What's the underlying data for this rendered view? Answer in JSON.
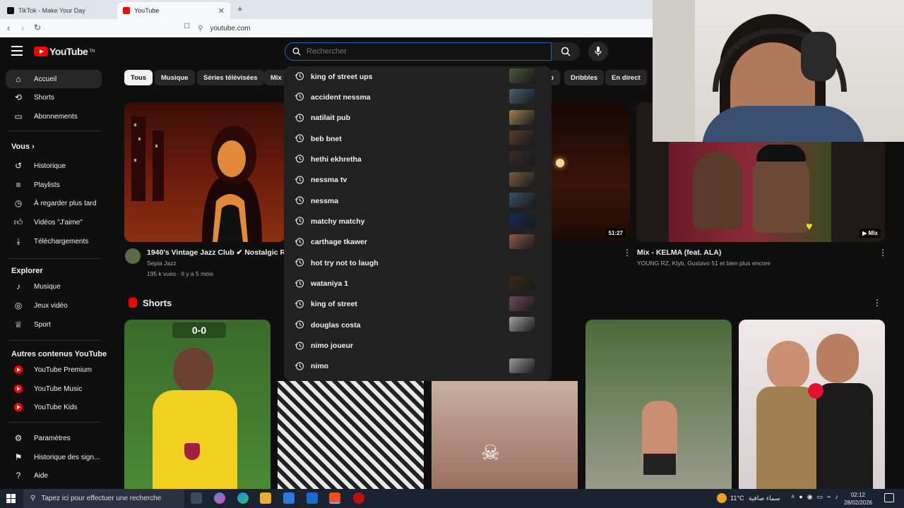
{
  "browser": {
    "tabs": [
      {
        "title": "TikTok - Make Your Day",
        "active": false
      },
      {
        "title": "YouTube",
        "active": true
      }
    ],
    "url": "youtube.com"
  },
  "header": {
    "logo_text": "YouTube",
    "logo_tm": "TN",
    "search_placeholder": "Rechercher"
  },
  "sidebar": {
    "main": [
      {
        "label": "Accueil",
        "icon": "home-icon"
      },
      {
        "label": "Shorts",
        "icon": "shorts-icon"
      },
      {
        "label": "Abonnements",
        "icon": "subscriptions-icon"
      }
    ],
    "you_heading": "Vous",
    "you": [
      {
        "label": "Historique",
        "icon": "history-icon"
      },
      {
        "label": "Playlists",
        "icon": "playlist-icon"
      },
      {
        "label": "À regarder plus tard",
        "icon": "clock-icon"
      },
      {
        "label": "Vidéos \"J'aime\"",
        "icon": "like-icon"
      },
      {
        "label": "Téléchargements",
        "icon": "download-icon"
      }
    ],
    "explore_heading": "Explorer",
    "explore": [
      {
        "label": "Musique",
        "icon": "music-icon"
      },
      {
        "label": "Jeux vidéo",
        "icon": "gaming-icon"
      },
      {
        "label": "Sport",
        "icon": "trophy-icon"
      }
    ],
    "more_heading": "Autres contenus YouTube",
    "more": [
      {
        "label": "YouTube Premium"
      },
      {
        "label": "YouTube Music"
      },
      {
        "label": "YouTube Kids"
      }
    ],
    "settings": [
      {
        "label": "Paramètres",
        "icon": "gear-icon"
      },
      {
        "label": "Historique des sign...",
        "icon": "flag-icon"
      },
      {
        "label": "Aide",
        "icon": "help-icon"
      }
    ]
  },
  "chips": [
    "Tous",
    "Musique",
    "Séries télévisées",
    "Mix",
    "Dribbles",
    "En direct"
  ],
  "videos": [
    {
      "title": "1940's Vintage Jazz Club ✔ Nostalgic R",
      "channel": "Sepia Jazz",
      "meta": "195 k vues · Il y a 5 mois"
    },
    {
      "duration": "51:27"
    },
    {
      "title": "Mix - KELMA (feat. ALA)",
      "channel": "YOUNG RZ, Ktyb, Gustavo 51 et bien plus encore",
      "badge": "Mix"
    }
  ],
  "shorts_heading": "Shorts",
  "shorts_score": "0-0",
  "suggestions": [
    "king of street ups",
    "accident nessma",
    "natilait pub",
    "beb bnet",
    "hethi ekhretha",
    "nessma tv",
    "nessma",
    "matchy matchy",
    "carthage tkawer",
    "hot try not to laugh",
    "wataniya 1",
    "king of street",
    "douglas costa",
    "nimo joueur",
    "nimo"
  ],
  "taskbar": {
    "search_placeholder": "Tapez ici pour effectuer une recherche",
    "weather": "11°C",
    "weather_text": "سماء صافية",
    "time": "02:12",
    "date": "28/02/2026"
  }
}
